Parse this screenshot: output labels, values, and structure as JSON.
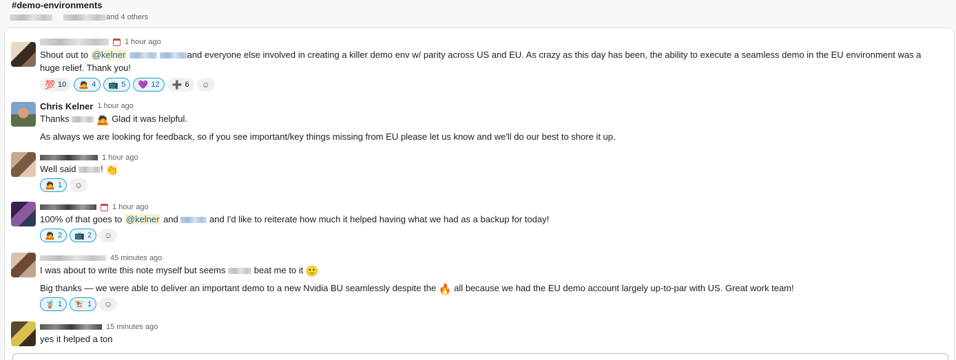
{
  "channel": {
    "name": "#demo-environments",
    "participants_suffix": "and 4 others"
  },
  "messages": [
    {
      "timestamp": "1 hour ago",
      "text_a": "Shout out to ",
      "mention": "@kelner",
      "text_b": "and everyone else involved in creating a killer demo env w/ parity across US and EU.  As crazy as this day has been, the ability to execute a seamless demo in the EU environment was a huge relief.  Thank you!",
      "reactions": [
        {
          "emoji": "💯",
          "count": "10"
        },
        {
          "emoji": "🙇",
          "count": "4"
        },
        {
          "emoji": "📺",
          "count": "5"
        },
        {
          "emoji": "💜",
          "count": "12"
        },
        {
          "emoji": "➕",
          "count": "6"
        }
      ]
    },
    {
      "author": "Chris Kelner",
      "timestamp": "1 hour ago",
      "line1_a": "Thanks",
      "line1_emoji": "🙇",
      "line1_b": " Glad it was helpful.",
      "line2": "As always we are looking for feedback, so if you see important/key things missing from EU please let us know and we'll do our best to shore it up."
    },
    {
      "timestamp": "1 hour ago",
      "text": "Well said ",
      "text_end": "!",
      "emoji": "👏",
      "reactions": [
        {
          "emoji": "🙇",
          "count": "1"
        }
      ]
    },
    {
      "timestamp": "1 hour ago",
      "text_a": "100% of that goes to ",
      "mention": "@kelner",
      "text_b": " and ",
      "text_c": " and I'd like to reiterate how much it helped having what we had as a backup for today!",
      "reactions": [
        {
          "emoji": "🙇",
          "count": "2"
        },
        {
          "emoji": "📺",
          "count": "2"
        }
      ]
    },
    {
      "timestamp": "45 minutes ago",
      "line1_a": "I was about to write this note myself but seems ",
      "line1_b": "beat me to it ",
      "line1_emoji": "🙂",
      "line2_a": "Big thanks — we were able to deliver an important demo to a new Nvidia BU seamlessly despite the ",
      "line2_emoji": "🔥",
      "line2_b": " all because we had the EU demo account largely up-to-par with US. Great work team!",
      "reactions": [
        {
          "emoji": "🧋",
          "count": "1"
        },
        {
          "emoji": "🐮",
          "count": "1"
        }
      ]
    },
    {
      "timestamp": "15 minutes ago",
      "text": "yes it helped a ton"
    }
  ],
  "icons": {
    "add_reaction": "add-reaction-icon",
    "calendar": "calendar-icon"
  },
  "colors": {
    "mention_bg": "#fdf0c5",
    "mention_fg": "#1264a3",
    "reaction_active_border": "#1d9bd1",
    "reaction_active_bg": "#e8f5fa"
  }
}
